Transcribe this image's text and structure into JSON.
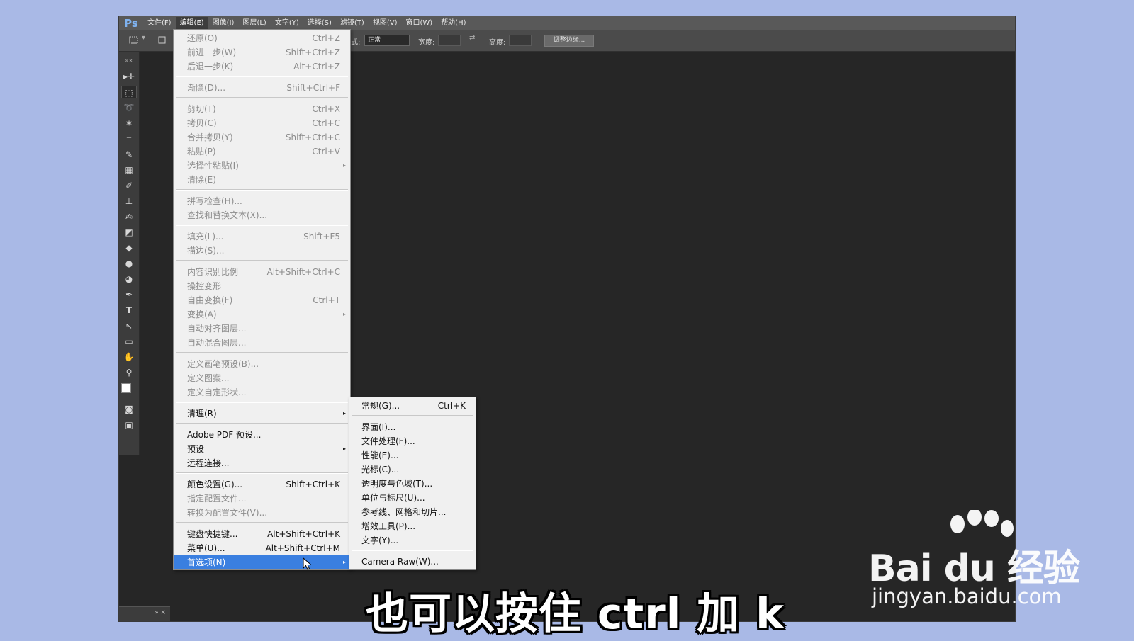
{
  "menubar": {
    "logo": "Ps",
    "items": [
      "文件(F)",
      "编辑(E)",
      "图像(I)",
      "图层(L)",
      "文字(Y)",
      "选择(S)",
      "滤镜(T)",
      "视图(V)",
      "窗口(W)",
      "帮助(H)"
    ]
  },
  "optionsbar": {
    "style_suffix": "式:",
    "style_value": "正常",
    "width_label": "宽度:",
    "height_label": "高度:",
    "refine_button": "调整边缘..."
  },
  "edit_menu": {
    "items": [
      {
        "label": "还原(O)",
        "shortcut": "Ctrl+Z"
      },
      {
        "label": "前进一步(W)",
        "shortcut": "Shift+Ctrl+Z"
      },
      {
        "label": "后退一步(K)",
        "shortcut": "Alt+Ctrl+Z"
      },
      {
        "label": "渐隐(D)...",
        "shortcut": "Shift+Ctrl+F"
      },
      {
        "label": "剪切(T)",
        "shortcut": "Ctrl+X"
      },
      {
        "label": "拷贝(C)",
        "shortcut": "Ctrl+C"
      },
      {
        "label": "合并拷贝(Y)",
        "shortcut": "Shift+Ctrl+C"
      },
      {
        "label": "粘贴(P)",
        "shortcut": "Ctrl+V"
      },
      {
        "label": "选择性粘贴(I)",
        "shortcut": ""
      },
      {
        "label": "清除(E)",
        "shortcut": ""
      },
      {
        "label": "拼写检查(H)...",
        "shortcut": ""
      },
      {
        "label": "查找和替换文本(X)...",
        "shortcut": ""
      },
      {
        "label": "填充(L)...",
        "shortcut": "Shift+F5"
      },
      {
        "label": "描边(S)...",
        "shortcut": ""
      },
      {
        "label": "内容识别比例",
        "shortcut": "Alt+Shift+Ctrl+C"
      },
      {
        "label": "操控变形",
        "shortcut": ""
      },
      {
        "label": "自由变换(F)",
        "shortcut": "Ctrl+T"
      },
      {
        "label": "变换(A)",
        "shortcut": ""
      },
      {
        "label": "自动对齐图层...",
        "shortcut": ""
      },
      {
        "label": "自动混合图层...",
        "shortcut": ""
      },
      {
        "label": "定义画笔预设(B)...",
        "shortcut": ""
      },
      {
        "label": "定义图案...",
        "shortcut": ""
      },
      {
        "label": "定义自定形状...",
        "shortcut": ""
      },
      {
        "label": "清理(R)",
        "shortcut": ""
      },
      {
        "label": "Adobe PDF 预设...",
        "shortcut": ""
      },
      {
        "label": "预设",
        "shortcut": ""
      },
      {
        "label": "远程连接...",
        "shortcut": ""
      },
      {
        "label": "颜色设置(G)...",
        "shortcut": "Shift+Ctrl+K"
      },
      {
        "label": "指定配置文件...",
        "shortcut": ""
      },
      {
        "label": "转换为配置文件(V)...",
        "shortcut": ""
      },
      {
        "label": "键盘快捷键...",
        "shortcut": "Alt+Shift+Ctrl+K"
      },
      {
        "label": "菜单(U)...",
        "shortcut": "Alt+Shift+Ctrl+M"
      },
      {
        "label": "首选项(N)",
        "shortcut": ""
      }
    ]
  },
  "preferences_submenu": {
    "items": [
      {
        "label": "常规(G)...",
        "shortcut": "Ctrl+K"
      },
      {
        "label": "界面(I)...",
        "shortcut": ""
      },
      {
        "label": "文件处理(F)...",
        "shortcut": ""
      },
      {
        "label": "性能(E)...",
        "shortcut": ""
      },
      {
        "label": "光标(C)...",
        "shortcut": ""
      },
      {
        "label": "透明度与色域(T)...",
        "shortcut": ""
      },
      {
        "label": "单位与标尺(U)...",
        "shortcut": ""
      },
      {
        "label": "参考线、网格和切片...",
        "shortcut": ""
      },
      {
        "label": "增效工具(P)...",
        "shortcut": ""
      },
      {
        "label": "文字(Y)...",
        "shortcut": ""
      },
      {
        "label": "Camera Raw(W)...",
        "shortcut": ""
      }
    ]
  },
  "subtitle": "也可以按住 ctrl 加 k",
  "watermark": {
    "brand": "Bai du 经验",
    "url": "jingyan.baidu.com"
  },
  "icons": {
    "submenu_arrow": "▸"
  }
}
